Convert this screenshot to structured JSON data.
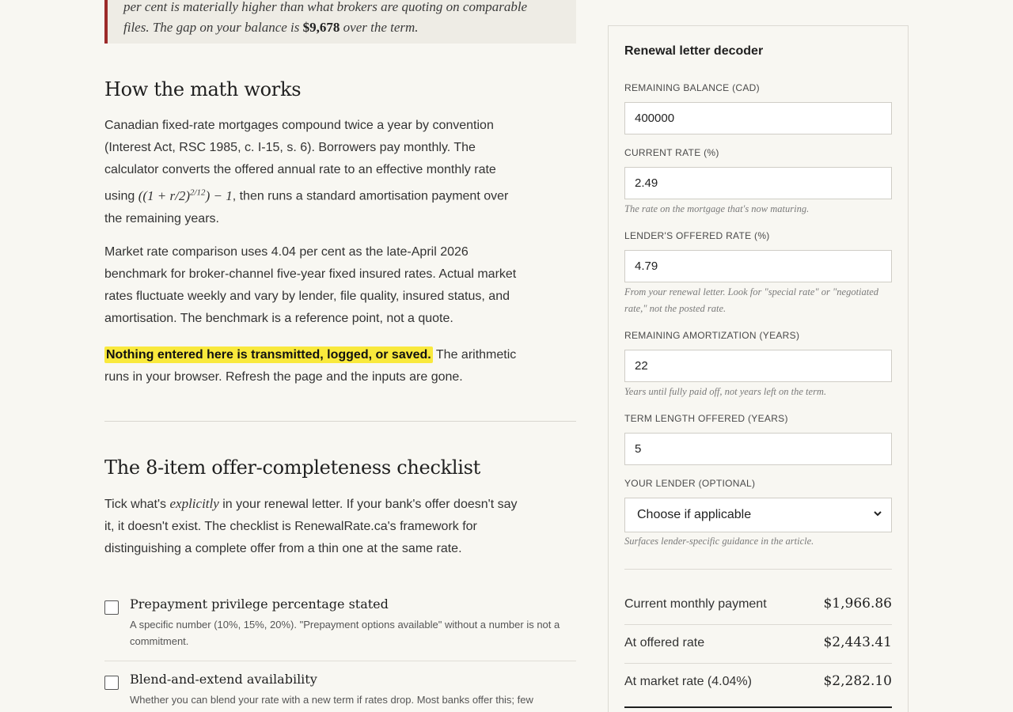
{
  "callout": {
    "line1": "per cent is materially higher than what brokers are quoting on comparable",
    "line2_pre": "files. The gap on your balance is ",
    "gap": "$9,678",
    "line2_post": " over the term."
  },
  "math": {
    "heading": "How the math works",
    "p1_a": "Canadian fixed-rate mortgages compound twice a year by convention (Interest Act, RSC 1985, c. I-15, s. 6). Borrowers pay monthly. The calculator converts the offered annual rate to an effective monthly rate using ",
    "p1_formula_a": "((1 + r/2)",
    "p1_formula_exp": "2/12",
    "p1_formula_b": ") − 1",
    "p1_b": ", then runs a standard amortisation payment over the remaining years.",
    "p2": "Market rate comparison uses 4.04 per cent as the late-April 2026 benchmark for broker-channel five-year fixed insured rates. Actual market rates fluctuate weekly and vary by lender, file quality, insured status, and amortisation. The benchmark is a reference point, not a quote.",
    "p3_highlight": "Nothing entered here is transmitted, logged, or saved.",
    "p3_rest": " The arithmetic runs in your browser. Refresh the page and the inputs are gone."
  },
  "checklist": {
    "heading": "The 8-item offer-completeness checklist",
    "intro_a": "Tick what's ",
    "intro_em": "explicitly",
    "intro_b": " in your renewal letter. If your bank's offer doesn't say it, it doesn't exist. The checklist is RenewalRate.ca's framework for distinguishing a complete offer from a thin one at the same rate.",
    "items": [
      {
        "title": "Prepayment privilege percentage stated",
        "desc": "A specific number (10%, 15%, 20%). \"Prepayment options available\" without a number is not a commitment."
      },
      {
        "title": "Blend-and-extend availability",
        "desc": "Whether you can blend your rate with a new term if rates drop. Most banks offer this; few"
      }
    ]
  },
  "decoder": {
    "title": "Renewal letter decoder",
    "balance_label": "Remaining balance (CAD)",
    "balance_value": "400000",
    "current_rate_label": "Current rate (%)",
    "current_rate_value": "2.49",
    "current_rate_hint": "The rate on the mortgage that's now maturing.",
    "offered_rate_label": "Lender's offered rate (%)",
    "offered_rate_value": "4.79",
    "offered_rate_hint": "From your renewal letter. Look for \"special rate\" or \"negotiated rate,\" not the posted rate.",
    "amort_label": "Remaining amortization (years)",
    "amort_value": "22",
    "amort_hint": "Years until fully paid off, not years left on the term.",
    "term_label": "Term length offered (years)",
    "term_value": "5",
    "lender_label": "Your lender (optional)",
    "lender_value": "Choose if applicable",
    "lender_hint": "Surfaces lender-specific guidance in the article.",
    "results": [
      {
        "label": "Current monthly payment",
        "value": "$1,966.86"
      },
      {
        "label": "At offered rate",
        "value": "$2,443.41"
      },
      {
        "label": "At market rate (4.04%)",
        "value": "$2,282.10"
      }
    ]
  }
}
